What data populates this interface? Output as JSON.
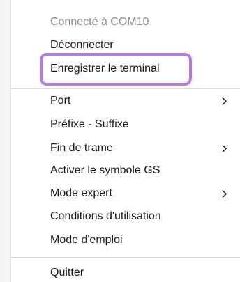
{
  "menu": {
    "status": "Connecté à COM10",
    "disconnect": "Déconnecter",
    "save_terminal": "Enregistrer le terminal",
    "port": "Port",
    "prefix_suffix": "Préfixe - Suffixe",
    "frame_end": "Fin de trame",
    "gs_symbol": "Activer le symbole GS",
    "expert_mode": "Mode expert",
    "terms": "Conditions d'utilisation",
    "manual": "Mode d'emploi",
    "quit": "Quitter"
  },
  "highlight_color": "#b77be6",
  "icons": {
    "submenu": "chevron-right-icon"
  }
}
